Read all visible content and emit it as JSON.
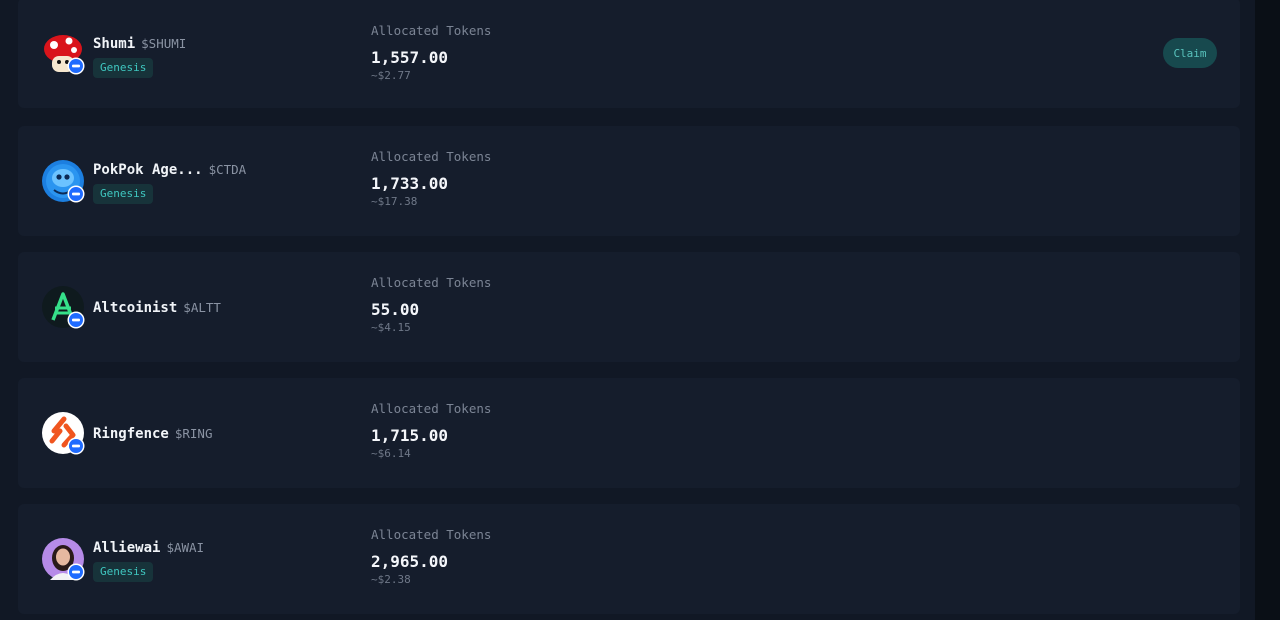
{
  "allocations": {
    "label": "Allocated Tokens",
    "items": [
      {
        "name": "Shumi",
        "ticker": "$SHUMI",
        "tag": "Genesis",
        "amount": "1,557.00",
        "usd": "~$2.77",
        "claim_label": "Claim",
        "avatar_icon": "mushroom-avatar-icon"
      },
      {
        "name": "PokPok Age...",
        "ticker": "$CTDA",
        "tag": "Genesis",
        "amount": "1,733.00",
        "usd": "~$17.38",
        "avatar_icon": "blue-creature-avatar-icon"
      },
      {
        "name": "Altcoinist",
        "ticker": "$ALTT",
        "amount": "55.00",
        "usd": "~$4.15",
        "avatar_icon": "altcoinist-logo-icon"
      },
      {
        "name": "Ringfence",
        "ticker": "$RING",
        "amount": "1,715.00",
        "usd": "~$6.14",
        "avatar_icon": "ringfence-logo-icon"
      },
      {
        "name": "Alliewai",
        "ticker": "$AWAI",
        "tag": "Genesis",
        "amount": "2,965.00",
        "usd": "~$2.38",
        "avatar_icon": "alliewai-avatar-icon"
      }
    ]
  },
  "colors": {
    "background": "#111825",
    "card": "#151d2c",
    "accent": "#3fc7c0",
    "chain_badge": "#1f6bff"
  }
}
